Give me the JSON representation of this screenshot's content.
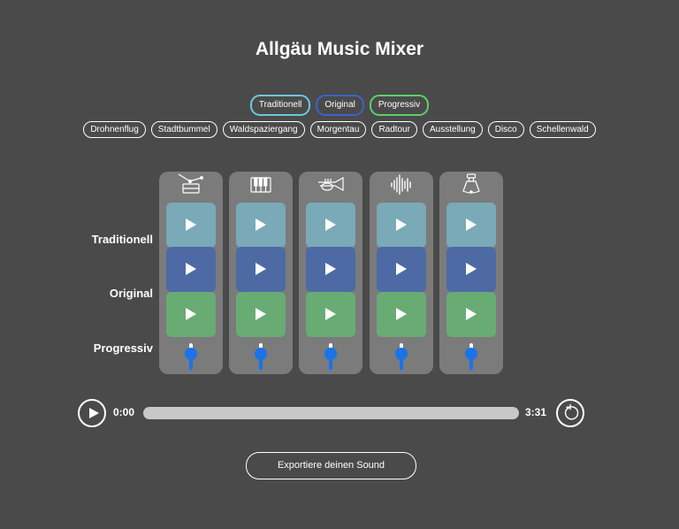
{
  "title": "Allgäu Music Mixer",
  "styles": [
    {
      "label": "Traditionell",
      "color": "#6fc6e0"
    },
    {
      "label": "Original",
      "color": "#3b64c8"
    },
    {
      "label": "Progressiv",
      "color": "#5cd06a"
    }
  ],
  "presets": [
    "Drohnenflug",
    "Stadtbummel",
    "Waldspaziergang",
    "Morgentau",
    "Radtour",
    "Ausstellung",
    "Disco",
    "Schellenwald"
  ],
  "row_labels": [
    "Traditionell",
    "Original",
    "Progressiv"
  ],
  "pad_colors": {
    "traditionell": "#7aa9b8",
    "original": "#4d6aa4",
    "progressiv": "#68ac74"
  },
  "channels": [
    {
      "icon": "drum-icon",
      "volume": 0.7
    },
    {
      "icon": "keyboard-icon",
      "volume": 0.7
    },
    {
      "icon": "trumpet-icon",
      "volume": 0.7
    },
    {
      "icon": "waveform-icon",
      "volume": 0.7
    },
    {
      "icon": "cowbell-icon",
      "volume": 0.7
    }
  ],
  "player": {
    "current_time": "0:00",
    "total_time": "3:31",
    "progress": 0
  },
  "export_label": "Exportiere deinen Sound",
  "accent_color": "#1a73e8"
}
